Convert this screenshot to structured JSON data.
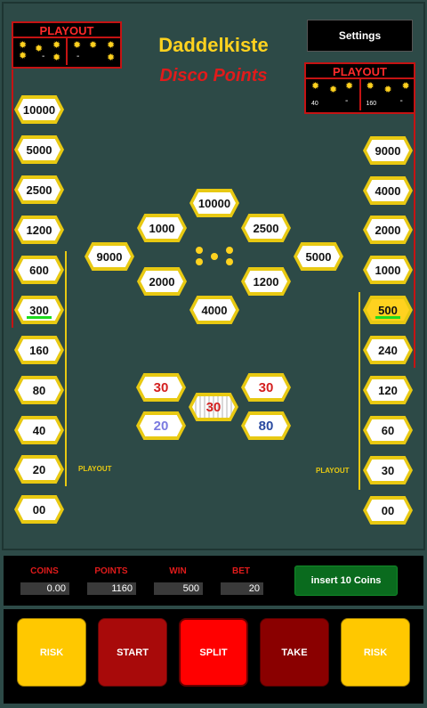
{
  "header": {
    "title": "Daddelkiste",
    "subtitle": "Disco Points",
    "settings_label": "Settings"
  },
  "playout_left": {
    "label": "PLAYOUT",
    "cells": [
      {
        "value": "",
        "dash": "-"
      },
      {
        "value": "-",
        "dash": ""
      }
    ]
  },
  "playout_right": {
    "label": "PLAYOUT",
    "cells": [
      {
        "value": "40",
        "dash": "-"
      },
      {
        "value": "160",
        "dash": "-"
      }
    ]
  },
  "left_ladder": [
    "10000",
    "5000",
    "2500",
    "1200",
    "600",
    "300",
    "160",
    "80",
    "40",
    "20",
    "00"
  ],
  "left_ladder_marked": "300",
  "right_ladder": [
    "9000",
    "4000",
    "2000",
    "1000",
    "500",
    "240",
    "120",
    "60",
    "30",
    "00"
  ],
  "right_ladder_lit": "500",
  "center_ring": {
    "top": "10000",
    "upper_left": "1000",
    "upper_right": "2500",
    "left": "9000",
    "right": "5000",
    "lower_left": "2000",
    "lower_right": "1200",
    "bottom": "4000"
  },
  "reels": {
    "top_left": "30",
    "top_right": "30",
    "center": "30",
    "bottom_left": "20",
    "bottom_right": "80"
  },
  "playout_labels": {
    "left": "PLAYOUT",
    "right": "PLAYOUT"
  },
  "stats": {
    "coins_label": "COINS",
    "coins_value": "0.00",
    "points_label": "POINTS",
    "points_value": "1160",
    "win_label": "WIN",
    "win_value": "500",
    "bet_label": "BET",
    "bet_value": "20"
  },
  "insert_label": "insert 10 Coins",
  "controls": {
    "risk_left": "RISK",
    "start": "START",
    "split": "SPLIT",
    "take": "TAKE",
    "risk_right": "RISK"
  },
  "colors": {
    "background": "#2d4a47",
    "accent_yellow": "#ffd21f",
    "accent_red": "#e01b1b",
    "insert_green": "#0a6b1e"
  }
}
